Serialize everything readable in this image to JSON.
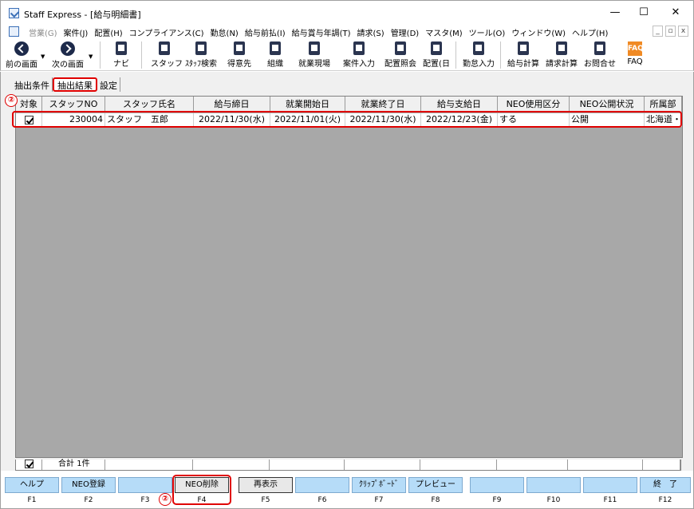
{
  "window": {
    "title": "Staff Express - [給与明細書]",
    "controls": [
      "—",
      "☐",
      "✕"
    ]
  },
  "menu": {
    "items": [
      {
        "label": "営業(G)",
        "disabled": true
      },
      {
        "label": "案件(J)",
        "disabled": false
      },
      {
        "label": "配置(H)",
        "disabled": false
      },
      {
        "label": "コンプライアンス(C)",
        "disabled": false
      },
      {
        "label": "勤怠(N)",
        "disabled": false
      },
      {
        "label": "給与前払(I)",
        "disabled": false
      },
      {
        "label": "給与賞与年調(T)",
        "disabled": false
      },
      {
        "label": "請求(S)",
        "disabled": false
      },
      {
        "label": "管理(D)",
        "disabled": false
      },
      {
        "label": "マスタ(M)",
        "disabled": false
      },
      {
        "label": "ツール(O)",
        "disabled": false
      },
      {
        "label": "ウィンドウ(W)",
        "disabled": false
      },
      {
        "label": "ヘルプ(H)",
        "disabled": false
      }
    ],
    "mdi_controls": [
      "_",
      "▫",
      "x"
    ]
  },
  "toolbar": {
    "prev": "前の画面",
    "next": "次の画面",
    "navi": "ナビ",
    "staff": "スタッフ",
    "staff_search": "ｽﾀｯﾌ検索",
    "client": "得意先",
    "org": "組織",
    "worksite": "就業現場",
    "case_entry": "案件入力",
    "assign_ref": "配置照会",
    "assign_day": "配置(日",
    "attendance": "勤怠入力",
    "payroll_calc": "給与計算",
    "billing_calc": "請求計算",
    "contact": "お問合せ",
    "faq": "FAQ",
    "faq_icon_text": "FAQ"
  },
  "tabs": [
    "抽出条件",
    "抽出結果",
    "設定"
  ],
  "grid": {
    "columns": [
      "対象",
      "スタッフNO",
      "スタッフ氏名",
      "給与締日",
      "就業開始日",
      "就業終了日",
      "給与支給日",
      "NEO使用区分",
      "NEO公開状況",
      "所属部"
    ],
    "rows": [
      {
        "checked": true,
        "staff_no": "230004",
        "staff_name": "スタッフ　五郎",
        "pay_close": "2022/11/30(水)",
        "work_start": "2022/11/01(火)",
        "work_end": "2022/11/30(水)",
        "pay_date": "2022/12/23(金)",
        "neo_use": "する",
        "neo_status": "公開",
        "dept": "北海道・"
      }
    ],
    "total_label": "合計 1件",
    "total_checked": true
  },
  "markers": [
    "②",
    "②"
  ],
  "fkeys": [
    {
      "label": "ヘルプ",
      "num": "F1"
    },
    {
      "label": "NEO登録",
      "num": "F2"
    },
    {
      "label": "",
      "num": "F3"
    },
    {
      "label": "NEO削除",
      "num": "F4"
    },
    {
      "label": "再表示",
      "num": "F5"
    },
    {
      "label": "",
      "num": "F6"
    },
    {
      "label": "ｸﾘｯﾌﾟﾎﾞｰﾄﾞ",
      "num": "F7"
    },
    {
      "label": "プレビュー",
      "num": "F8"
    },
    {
      "label": "",
      "num": "F9"
    },
    {
      "label": "",
      "num": "F10"
    },
    {
      "label": "",
      "num": "F11"
    },
    {
      "label": "終　了",
      "num": "F12"
    }
  ],
  "colors": {
    "highlight": "#e00000",
    "fkey_bg": "#b6dcf8",
    "grid_bg": "#a8a8a8"
  }
}
